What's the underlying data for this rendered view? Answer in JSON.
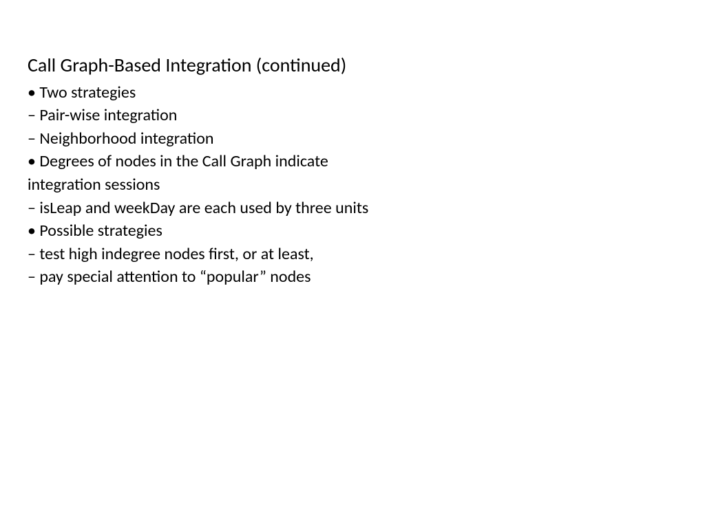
{
  "slide": {
    "title": "Call Graph-Based Integration (continued)",
    "lines": [
      "• Two strategies",
      "– Pair-wise integration",
      "– Neighborhood integration",
      "• Degrees of nodes in the Call Graph indicate",
      "integration sessions",
      "– isLeap and weekDay are each used by three units",
      "• Possible strategies",
      "– test high indegree nodes first, or at least,",
      "– pay special attention to “popular” nodes"
    ]
  }
}
